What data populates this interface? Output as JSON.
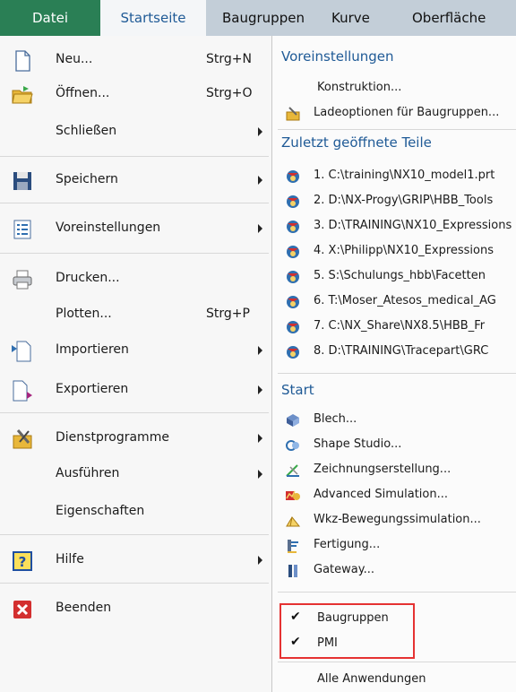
{
  "tabs": [
    "Datei",
    "Startseite",
    "Baugruppen",
    "Kurve",
    "Oberfläche"
  ],
  "left_menu": [
    {
      "label": "Neu...",
      "shortcut": "Strg+N",
      "icon": "new-file-icon"
    },
    {
      "label": "Öffnen...",
      "shortcut": "Strg+O",
      "icon": "open-folder-icon"
    },
    {
      "label": "Schließen",
      "icon": "none"
    },
    {
      "label": "Speichern",
      "icon": "save-icon"
    },
    {
      "label": "Voreinstellungen",
      "icon": "preferences-icon"
    },
    {
      "label": "Drucken...",
      "icon": "printer-icon"
    },
    {
      "label": "Plotten...",
      "shortcut": "Strg+P",
      "icon": "none"
    },
    {
      "label": "Importieren",
      "icon": "import-icon"
    },
    {
      "label": "Exportieren",
      "icon": "export-icon"
    },
    {
      "label": "Dienstprogramme",
      "icon": "utilities-icon"
    },
    {
      "label": "Ausführen",
      "icon": "none"
    },
    {
      "label": "Eigenschaften",
      "icon": "none"
    },
    {
      "label": "Hilfe",
      "icon": "help-icon"
    },
    {
      "label": "Beenden",
      "icon": "exit-icon"
    }
  ],
  "right": {
    "sections": {
      "prefs": "Voreinstellungen",
      "recent": "Zuletzt geöffnete Teile",
      "start": "Start"
    },
    "prefs_items": [
      "Konstruktion...",
      "Ladeoptionen für Baugruppen..."
    ],
    "recent_files": [
      "1. C:\\training\\NX10_model1.prt",
      "2. D:\\NX-Progy\\GRIP\\HBB_Tools",
      "3. D:\\TRAINING\\NX10_Expressions",
      "4. X:\\Philipp\\NX10_Expressions",
      "5. S:\\Schulungs_hbb\\Facetten",
      "6. T:\\Moser_Atesos_medical_AG",
      "7. C:\\NX_Share\\NX8.5\\HBB_Fr",
      "8. D:\\TRAINING\\Tracepart\\GRC"
    ],
    "start_items": [
      "Blech...",
      "Shape Studio...",
      "Zeichnungserstellung...",
      "Advanced Simulation...",
      "Wkz-Bewegungssimulation...",
      "Fertigung...",
      "Gateway..."
    ],
    "checked_items": [
      "Baugruppen",
      "PMI"
    ],
    "all_apps": "Alle Anwendungen"
  }
}
